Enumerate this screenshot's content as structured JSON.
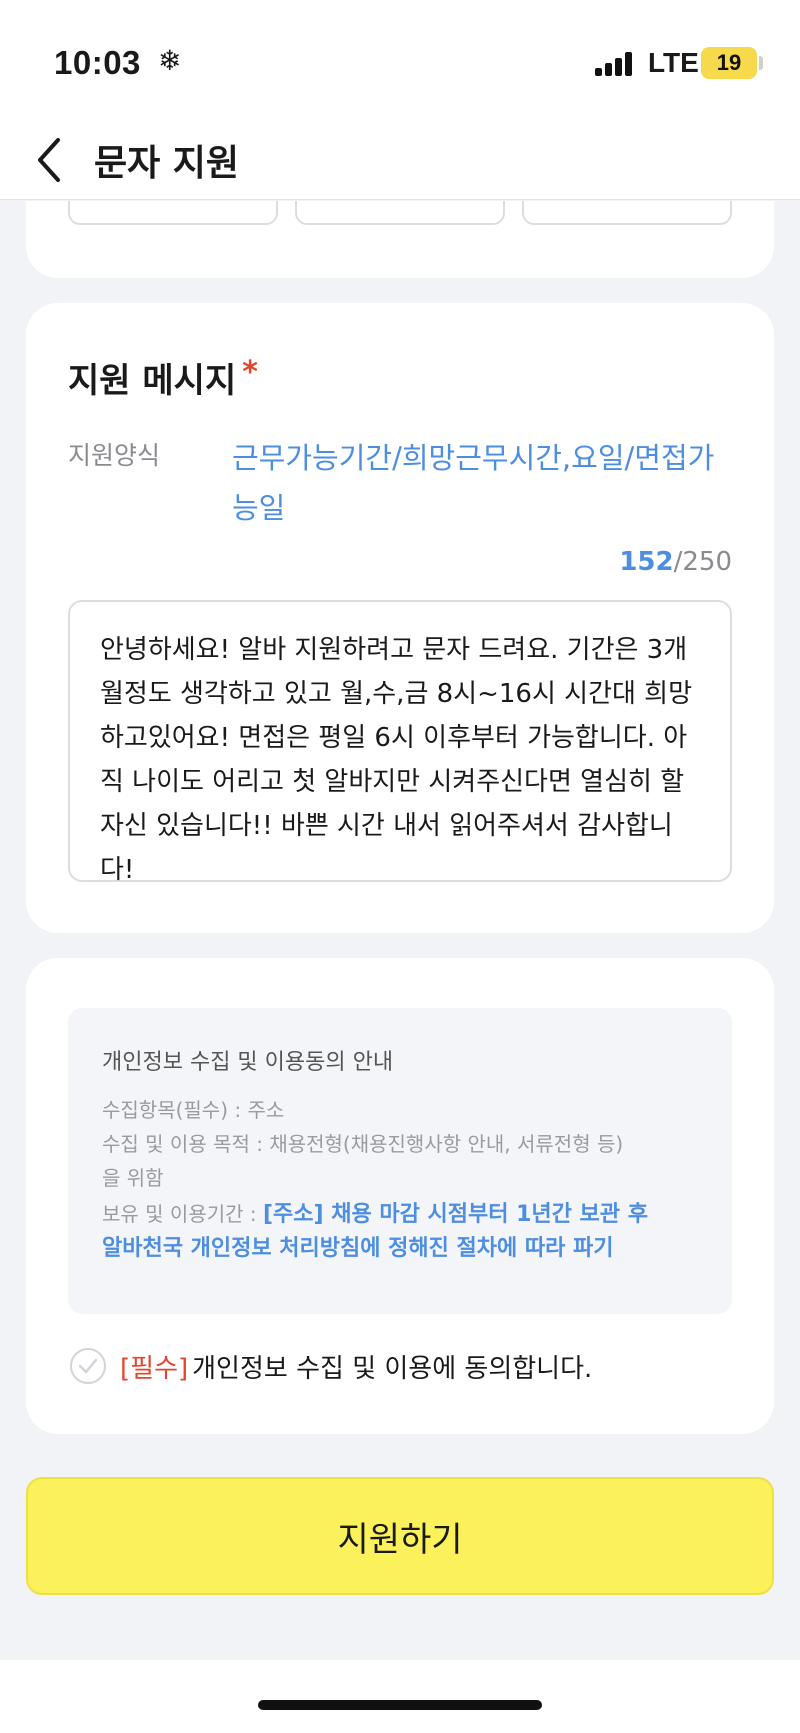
{
  "status_bar": {
    "time": "10:03",
    "network": "LTE",
    "battery": "19"
  },
  "header": {
    "title": "문자 지원"
  },
  "message_section": {
    "title": "지원 메시지",
    "required_mark": "*",
    "format_label": "지원양식",
    "format_value": "근무가능기간/희망근무시간,요일/면접가능일",
    "char_count": "152",
    "char_limit": "/250",
    "message": "안녕하세요! 알바 지원하려고 문자 드려요. 기간은 3개월정도 생각하고 있고 월,수,금 8시~16시 시간대 희망하고있어요! 면접은 평일 6시 이후부터 가능합니다. 아직 나이도 어리고 첫 알바지만 시켜주신다면 열심히 할 자신 있습니다!! 바쁜 시간 내서 읽어주셔서 감사합니다!"
  },
  "privacy": {
    "title": "개인정보 수집 및 이용동의 안내",
    "items_label": "수집항목(필수) : 주소",
    "purpose_line1": "수집 및 이용 목적 : 채용전형(채용진행사항 안내, 서류전형 등)",
    "purpose_line2": "을 위함",
    "retention_label": "보유 및 이용기간 : ",
    "retention_value_line1": "[주소] 채용 마감 시점부터 1년간 보관 후",
    "retention_value_line2": "알바천국 개인정보 처리방침에 정해진 절차에 따라 파기",
    "agree_required": "[필수]",
    "agree_text": "개인정보 수집 및 이용에 동의합니다."
  },
  "submit": {
    "label": "지원하기"
  },
  "colors": {
    "accent_blue": "#4d8ee0",
    "required_red": "#e3452e",
    "submit_yellow": "#fbf15a"
  }
}
